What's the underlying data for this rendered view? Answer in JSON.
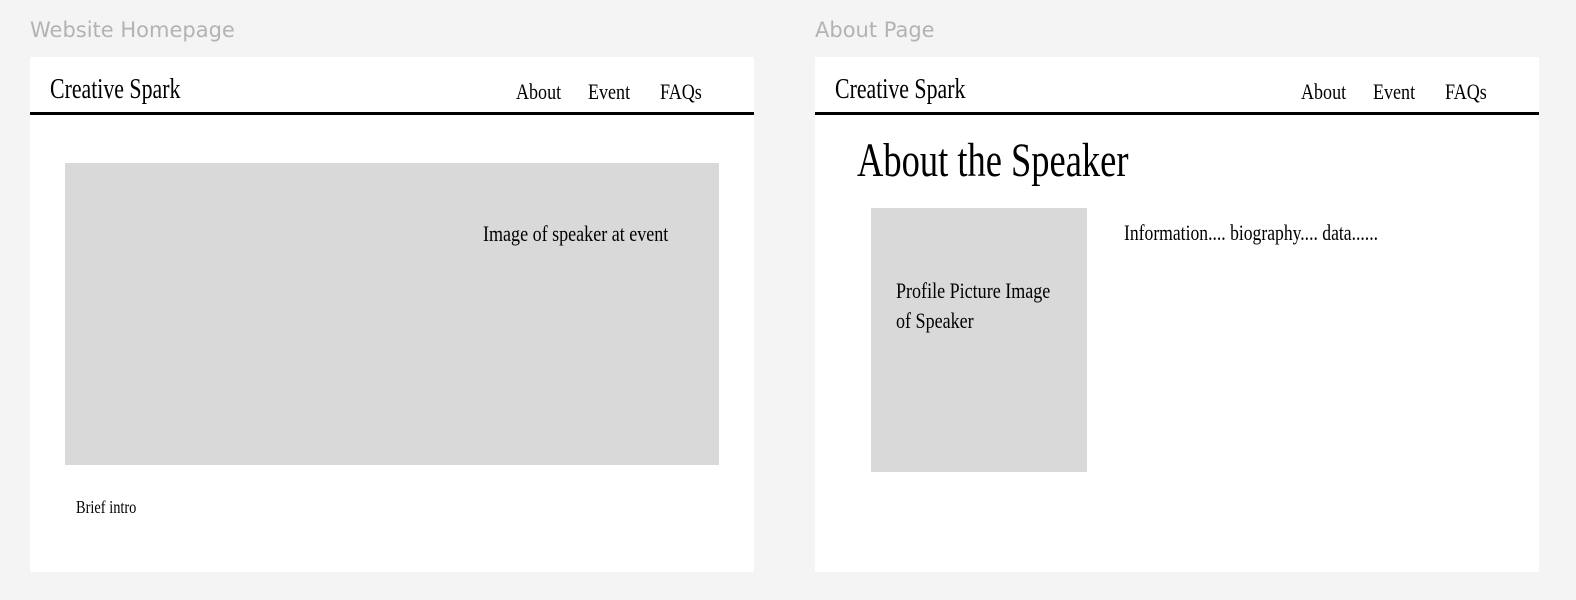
{
  "frames": {
    "home": {
      "label": "Website Homepage",
      "logo": "Creative Spark",
      "nav": [
        "About",
        "Event",
        "FAQs"
      ],
      "hero_image_text": "Image of speaker at event",
      "brief_intro": "Brief intro"
    },
    "about": {
      "label": "About Page",
      "logo": "Creative Spark",
      "nav": [
        "About",
        "Event",
        "FAQs"
      ],
      "heading": "About the Speaker",
      "profile_image_text_line1": "Profile Picture Image",
      "profile_image_text_line2": "of Speaker",
      "info_text": "Information.... biography.... data......"
    }
  },
  "colors": {
    "canvas": "#f4f4f4",
    "frame": "#ffffff",
    "placeholder": "#d9d9d9",
    "label": "#b3b3b3",
    "ink": "#000000"
  }
}
